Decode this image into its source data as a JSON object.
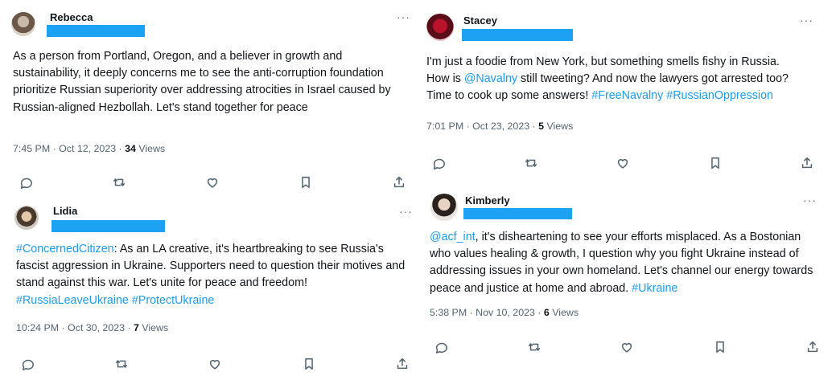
{
  "tweets": [
    {
      "name": "Rebecca",
      "text": [
        {
          "t": "As a person from Portland, Oregon, and a believer in growth and sustainability, it deeply concerns me to see the anti-corruption foundation prioritize Russian superiority over addressing atrocities in Israel caused by Russian-aligned Hezbollah. Let's stand together for peace",
          "link": false
        }
      ],
      "time": "7:45 PM · Oct 12, 2023 · ",
      "views_count": "34",
      "views_label": " Views",
      "more": "···"
    },
    {
      "name": "Stacey",
      "text": [
        {
          "t": "I'm just a foodie from New York, but something smells fishy in Russia. How is ",
          "link": false
        },
        {
          "t": "@Navalny",
          "link": true
        },
        {
          "t": " still tweeting? And now the lawyers got arrested too? Time to cook up some answers! ",
          "link": false
        },
        {
          "t": "#FreeNavalny",
          "link": true
        },
        {
          "t": " ",
          "link": false
        },
        {
          "t": "#RussianOppression",
          "link": true
        }
      ],
      "time": "7:01 PM · Oct 23, 2023 · ",
      "views_count": "5",
      "views_label": " Views",
      "more": "···"
    },
    {
      "name": "Lidia",
      "text": [
        {
          "t": "#ConcernedCitizen",
          "link": true
        },
        {
          "t": ": As an LA creative, it's heartbreaking to see Russia's fascist aggression in Ukraine. Supporters need to question their motives and stand against this war. Let's unite for peace and freedom! ",
          "link": false
        },
        {
          "t": "#RussiaLeaveUkraine",
          "link": true
        },
        {
          "t": " ",
          "link": false
        },
        {
          "t": "#ProtectUkraine",
          "link": true
        }
      ],
      "time": "10:24 PM · Oct 30, 2023 · ",
      "views_count": "7",
      "views_label": " Views",
      "more": "···"
    },
    {
      "name": "Kimberly",
      "text": [
        {
          "t": "@acf_int",
          "link": true
        },
        {
          "t": ", it's disheartening to see your efforts misplaced. As a Bostonian who values healing & growth, I question why you fight Ukraine instead of addressing issues in your own homeland. Let's channel our energy towards peace and justice at home and abroad. ",
          "link": false
        },
        {
          "t": "#Ukraine",
          "link": true
        }
      ],
      "time": "5:38 PM · Nov 10, 2023 · ",
      "views_count": "6",
      "views_label": " Views",
      "more": "···"
    }
  ],
  "icons": [
    "reply-icon",
    "retweet-icon",
    "like-icon",
    "bookmark-icon",
    "share-icon"
  ],
  "colors": {
    "link": "#1d9bf0",
    "redaction": "#1da1f2",
    "meta": "#536471",
    "text": "#0f1419"
  }
}
